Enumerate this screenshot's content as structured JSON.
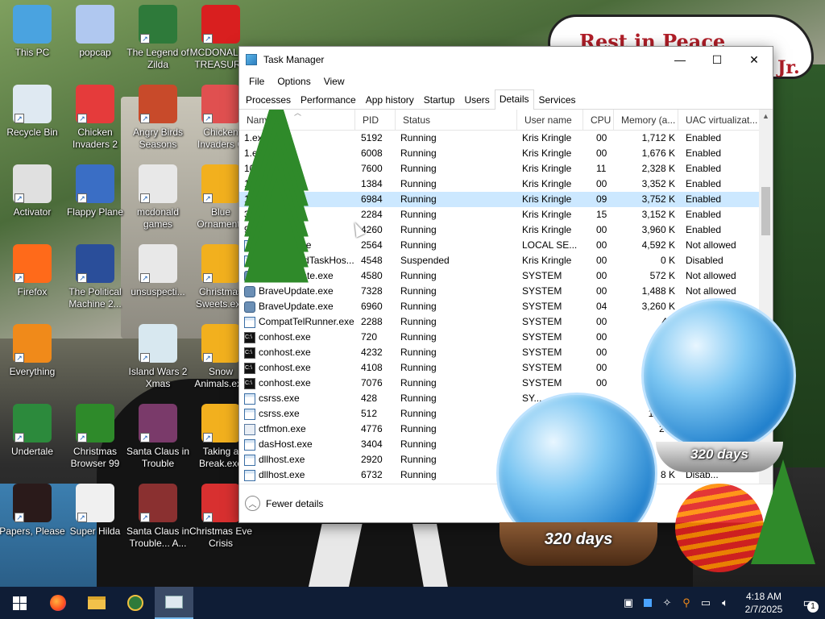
{
  "desktop": {
    "banner": {
      "line1": "Rest in Peace",
      "line2": "Jr."
    },
    "icons": [
      {
        "label": "This PC",
        "color": "#4aa3e0"
      },
      {
        "label": "popcap",
        "color": "#b0c8f0"
      },
      {
        "label": "The Legend of Zilda",
        "color": "#2e7a3a"
      },
      {
        "label": "MCDONALDS TREASURE",
        "color": "#d91f1f"
      },
      {
        "label": "Recycle Bin",
        "color": "#dfe9f2"
      },
      {
        "label": "Chicken Invaders 2",
        "color": "#e53b3b"
      },
      {
        "label": "Angry Birds Seasons",
        "color": "#c84a2a"
      },
      {
        "label": "Chicken Invaders C",
        "color": "#e05050"
      },
      {
        "label": "Activator",
        "color": "#e0e0e0"
      },
      {
        "label": "Flappy Plane",
        "color": "#3a6ec5"
      },
      {
        "label": "mcdonald games",
        "color": "#e8e8e8"
      },
      {
        "label": "Blue Ornaments",
        "color": "#f2b01e"
      },
      {
        "label": "Firefox",
        "color": "#ff6a1a"
      },
      {
        "label": "The Political Machine 2...",
        "color": "#2a4e9a"
      },
      {
        "label": "unsuspecti...",
        "color": "#e8e8e8"
      },
      {
        "label": "Christmas Sweets.exe",
        "color": "#f2b01e"
      },
      {
        "label": "Everything",
        "color": "#f08a1a"
      },
      {
        "label": "Island Wars 2 Xmas",
        "color": "#d8e8f0"
      },
      {
        "label": "Snow Animals.exe",
        "color": "#f2b01e"
      },
      {
        "label": "Undertale",
        "color": "#2c8a3c"
      },
      {
        "label": "Christmas Browser 99",
        "color": "#2e8a2a"
      },
      {
        "label": "Santa Claus in Trouble",
        "color": "#7a3a6a"
      },
      {
        "label": "Taking a Break.exe",
        "color": "#f2b01e"
      },
      {
        "label": "Papers, Please",
        "color": "#2a1a1a"
      },
      {
        "label": "Super Hilda",
        "color": "#f0f0f0"
      },
      {
        "label": "Santa Claus in Trouble... A...",
        "color": "#8a3030"
      },
      {
        "label": "Christmas Eve Crisis",
        "color": "#d83030"
      }
    ],
    "globe1_label": "320 days",
    "globe2_label": "320 days"
  },
  "window": {
    "title": "Task Manager",
    "minimize": "—",
    "maximize": "☐",
    "close": "✕",
    "menu": [
      "File",
      "Options",
      "View"
    ],
    "tabs": [
      "Processes",
      "Performance",
      "App history",
      "Startup",
      "Users",
      "Details",
      "Services"
    ],
    "active_tab": "Details",
    "columns": [
      "Name",
      "PID",
      "Status",
      "User name",
      "CPU",
      "Memory (a...",
      "UAC virtualizat..."
    ],
    "rows": [
      {
        "icon": "tree",
        "name": "1.exe",
        "pid": "5192",
        "status": "Running",
        "user": "Kris Kringle",
        "cpu": "00",
        "mem": "1,712 K",
        "uac": "Enabled"
      },
      {
        "icon": "tree",
        "name": "1.exe",
        "pid": "6008",
        "status": "Running",
        "user": "Kris Kringle",
        "cpu": "00",
        "mem": "1,676 K",
        "uac": "Enabled"
      },
      {
        "icon": "tree",
        "name": "10.exe",
        "pid": "7600",
        "status": "Running",
        "user": "Kris Kringle",
        "cpu": "11",
        "mem": "2,328 K",
        "uac": "Enabled"
      },
      {
        "icon": "tree",
        "name": "11.exe",
        "pid": "1384",
        "status": "Running",
        "user": "Kris Kringle",
        "cpu": "00",
        "mem": "3,352 K",
        "uac": "Enabled"
      },
      {
        "icon": "tree",
        "name": "11.exe",
        "pid": "6984",
        "status": "Running",
        "user": "Kris Kringle",
        "cpu": "09",
        "mem": "3,752 K",
        "uac": "Enabled",
        "selected": true
      },
      {
        "icon": "tree",
        "name": "3.exe",
        "pid": "2284",
        "status": "Running",
        "user": "Kris Kringle",
        "cpu": "15",
        "mem": "3,152 K",
        "uac": "Enabled"
      },
      {
        "icon": "tree",
        "name": "9.exe",
        "pid": "4260",
        "status": "Running",
        "user": "Kris Kringle",
        "cpu": "00",
        "mem": "3,960 K",
        "uac": "Enabled"
      },
      {
        "icon": "exe",
        "name": "audiodg.exe",
        "pid": "2564",
        "status": "Running",
        "user": "LOCAL SE...",
        "cpu": "00",
        "mem": "4,592 K",
        "uac": "Not allowed"
      },
      {
        "icon": "exe",
        "name": "backgroundTaskHos...",
        "pid": "4548",
        "status": "Suspended",
        "user": "Kris Kringle",
        "cpu": "00",
        "mem": "0 K",
        "uac": "Disabled"
      },
      {
        "icon": "brave",
        "name": "BraveUpdate.exe",
        "pid": "4580",
        "status": "Running",
        "user": "SYSTEM",
        "cpu": "00",
        "mem": "572 K",
        "uac": "Not allowed"
      },
      {
        "icon": "brave",
        "name": "BraveUpdate.exe",
        "pid": "7328",
        "status": "Running",
        "user": "SYSTEM",
        "cpu": "00",
        "mem": "1,488 K",
        "uac": "Not allowed"
      },
      {
        "icon": "brave",
        "name": "BraveUpdate.exe",
        "pid": "6960",
        "status": "Running",
        "user": "SYSTEM",
        "cpu": "04",
        "mem": "3,260 K",
        "uac": ""
      },
      {
        "icon": "exe",
        "name": "CompatTelRunner.exe",
        "pid": "2288",
        "status": "Running",
        "user": "SYSTEM",
        "cpu": "00",
        "mem": "4...",
        "uac": ""
      },
      {
        "icon": "con",
        "name": "conhost.exe",
        "pid": "720",
        "status": "Running",
        "user": "SYSTEM",
        "cpu": "00",
        "mem": "",
        "uac": ""
      },
      {
        "icon": "con",
        "name": "conhost.exe",
        "pid": "4232",
        "status": "Running",
        "user": "SYSTEM",
        "cpu": "00",
        "mem": "",
        "uac": ""
      },
      {
        "icon": "con",
        "name": "conhost.exe",
        "pid": "4108",
        "status": "Running",
        "user": "SYSTEM",
        "cpu": "00",
        "mem": "",
        "uac": ""
      },
      {
        "icon": "con",
        "name": "conhost.exe",
        "pid": "7076",
        "status": "Running",
        "user": "SYSTEM",
        "cpu": "00",
        "mem": "",
        "uac": ""
      },
      {
        "icon": "exe",
        "name": "csrss.exe",
        "pid": "428",
        "status": "Running",
        "user": "SY...",
        "cpu": "",
        "mem": "",
        "uac": ""
      },
      {
        "icon": "exe",
        "name": "csrss.exe",
        "pid": "512",
        "status": "Running",
        "user": "",
        "cpu": "",
        "mem": "1,04...",
        "uac": ""
      },
      {
        "icon": "edit",
        "name": "ctfmon.exe",
        "pid": "4776",
        "status": "Running",
        "user": "",
        "cpu": "",
        "mem": "236",
        "uac": ""
      },
      {
        "icon": "exe",
        "name": "dasHost.exe",
        "pid": "3404",
        "status": "Running",
        "user": "",
        "cpu": "",
        "mem": "",
        "uac": ""
      },
      {
        "icon": "exe",
        "name": "dllhost.exe",
        "pid": "2920",
        "status": "Running",
        "user": "",
        "cpu": "",
        "mem": "",
        "uac": ""
      },
      {
        "icon": "exe",
        "name": "dllhost.exe",
        "pid": "6732",
        "status": "Running",
        "user": "",
        "cpu": "",
        "mem": "8 K",
        "uac": "Disab..."
      }
    ],
    "fewer_details": "Fewer details"
  },
  "taskbar": {
    "time": "4:18 AM",
    "date": "2/7/2025",
    "notification_count": "1"
  }
}
